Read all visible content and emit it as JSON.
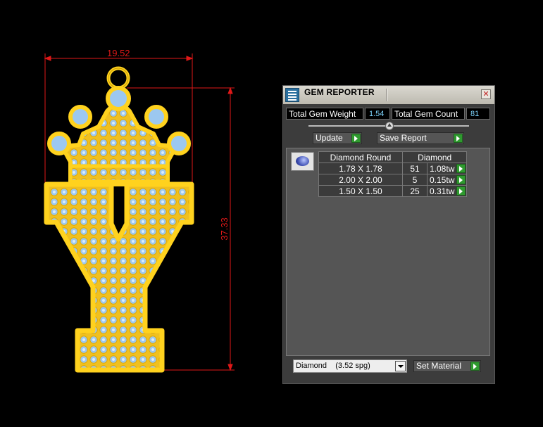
{
  "drawing": {
    "width_dim": "19.52",
    "height_dim": "37.33",
    "colors": {
      "metal": "#ffd21e",
      "gem": "#9cc8f0",
      "dimension": "#e01818"
    }
  },
  "panel": {
    "title": "GEM REPORTER",
    "close_icon": "close-icon",
    "total_gem_weight_label": "Total Gem Weight",
    "total_gem_weight": "1.54",
    "total_gem_count_label": "Total Gem Count",
    "total_gem_count": "81",
    "update_label": "Update",
    "save_report_label": "Save Report",
    "table": {
      "headers": [
        "Diamond Round",
        "Diamond"
      ],
      "rows": [
        {
          "size": "1.78 X 1.78",
          "count": "51",
          "weight": "1.08tw"
        },
        {
          "size": "2.00 X 2.00",
          "count": "5",
          "weight": "0.15tw"
        },
        {
          "size": "1.50 X 1.50",
          "count": "25",
          "weight": "0.31tw"
        }
      ]
    },
    "material_select": "Diamond    (3.52 spg)",
    "set_material_label": "Set Material"
  }
}
